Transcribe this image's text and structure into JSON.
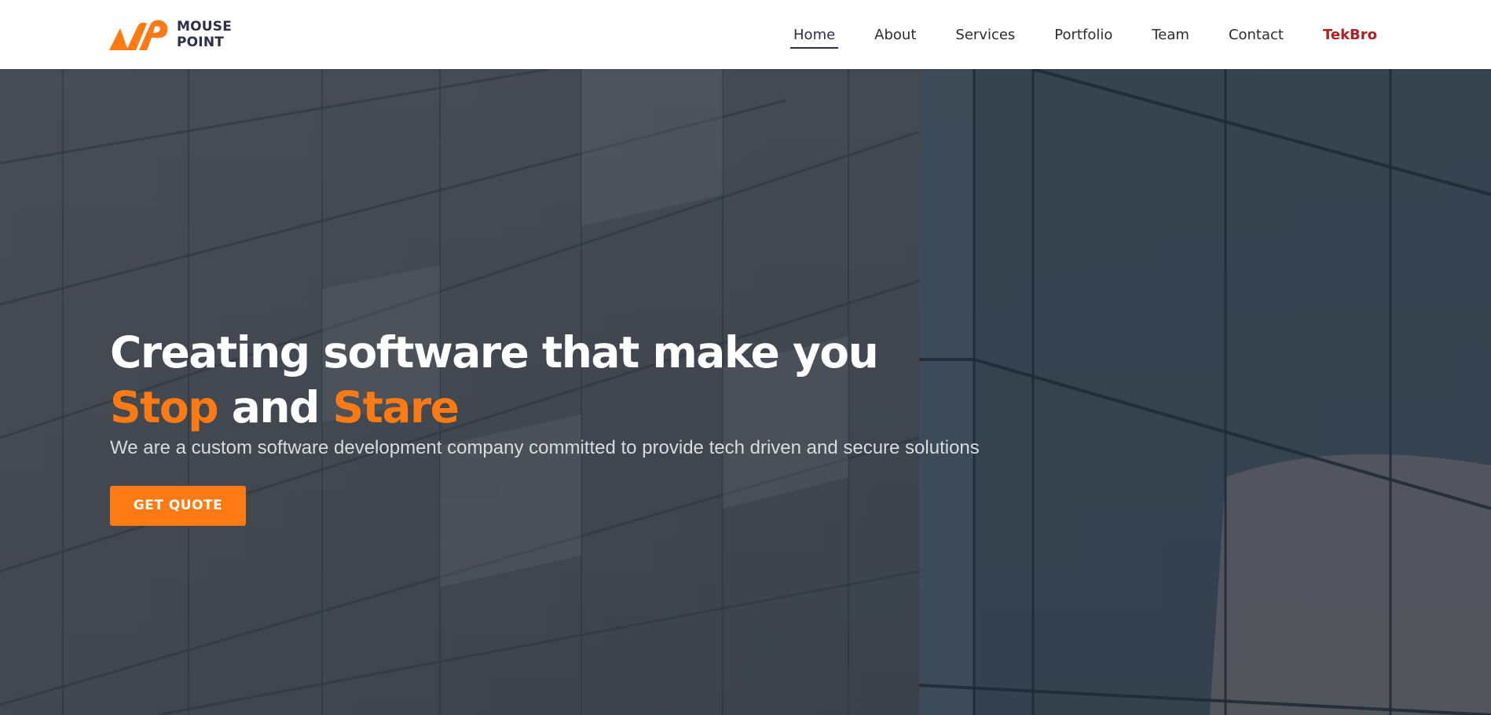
{
  "brand": {
    "logo_line1": "MOUSE",
    "logo_line2": "POINT",
    "logo_icon": "mousepoint-logo-icon",
    "accent_color": "#ff7a12"
  },
  "nav": {
    "items": [
      {
        "label": "Home",
        "active": true
      },
      {
        "label": "About"
      },
      {
        "label": "Services"
      },
      {
        "label": "Portfolio"
      },
      {
        "label": "Team"
      },
      {
        "label": "Contact"
      },
      {
        "label": "TekBro",
        "color": "#b01f24"
      }
    ]
  },
  "hero": {
    "title_line1": "Creating software that make you",
    "title_word1": "Stop",
    "title_mid": " and ",
    "title_word2": "Stare",
    "subtitle": "We are a custom software development company committed to provide tech driven and secure solutions",
    "cta_label": "GET QUOTE",
    "background": "glass-building-facade-image"
  }
}
